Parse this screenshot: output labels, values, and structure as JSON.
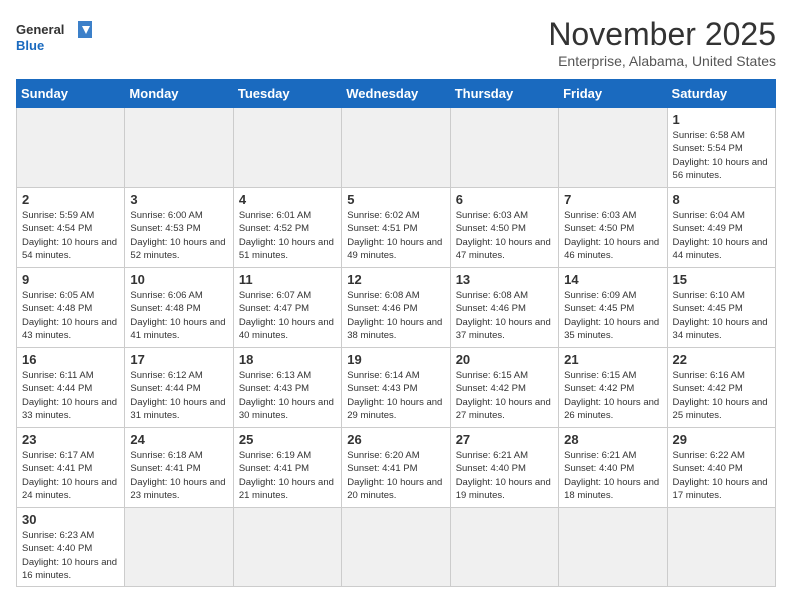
{
  "header": {
    "logo_line1": "General",
    "logo_line2": "Blue",
    "month": "November 2025",
    "location": "Enterprise, Alabama, United States"
  },
  "days_of_week": [
    "Sunday",
    "Monday",
    "Tuesday",
    "Wednesday",
    "Thursday",
    "Friday",
    "Saturday"
  ],
  "weeks": [
    [
      {
        "day": "",
        "info": ""
      },
      {
        "day": "",
        "info": ""
      },
      {
        "day": "",
        "info": ""
      },
      {
        "day": "",
        "info": ""
      },
      {
        "day": "",
        "info": ""
      },
      {
        "day": "",
        "info": ""
      },
      {
        "day": "1",
        "info": "Sunrise: 6:58 AM\nSunset: 5:54 PM\nDaylight: 10 hours and 56 minutes."
      }
    ],
    [
      {
        "day": "2",
        "info": "Sunrise: 5:59 AM\nSunset: 4:54 PM\nDaylight: 10 hours and 54 minutes."
      },
      {
        "day": "3",
        "info": "Sunrise: 6:00 AM\nSunset: 4:53 PM\nDaylight: 10 hours and 52 minutes."
      },
      {
        "day": "4",
        "info": "Sunrise: 6:01 AM\nSunset: 4:52 PM\nDaylight: 10 hours and 51 minutes."
      },
      {
        "day": "5",
        "info": "Sunrise: 6:02 AM\nSunset: 4:51 PM\nDaylight: 10 hours and 49 minutes."
      },
      {
        "day": "6",
        "info": "Sunrise: 6:03 AM\nSunset: 4:50 PM\nDaylight: 10 hours and 47 minutes."
      },
      {
        "day": "7",
        "info": "Sunrise: 6:03 AM\nSunset: 4:50 PM\nDaylight: 10 hours and 46 minutes."
      },
      {
        "day": "8",
        "info": "Sunrise: 6:04 AM\nSunset: 4:49 PM\nDaylight: 10 hours and 44 minutes."
      }
    ],
    [
      {
        "day": "9",
        "info": "Sunrise: 6:05 AM\nSunset: 4:48 PM\nDaylight: 10 hours and 43 minutes."
      },
      {
        "day": "10",
        "info": "Sunrise: 6:06 AM\nSunset: 4:48 PM\nDaylight: 10 hours and 41 minutes."
      },
      {
        "day": "11",
        "info": "Sunrise: 6:07 AM\nSunset: 4:47 PM\nDaylight: 10 hours and 40 minutes."
      },
      {
        "day": "12",
        "info": "Sunrise: 6:08 AM\nSunset: 4:46 PM\nDaylight: 10 hours and 38 minutes."
      },
      {
        "day": "13",
        "info": "Sunrise: 6:08 AM\nSunset: 4:46 PM\nDaylight: 10 hours and 37 minutes."
      },
      {
        "day": "14",
        "info": "Sunrise: 6:09 AM\nSunset: 4:45 PM\nDaylight: 10 hours and 35 minutes."
      },
      {
        "day": "15",
        "info": "Sunrise: 6:10 AM\nSunset: 4:45 PM\nDaylight: 10 hours and 34 minutes."
      }
    ],
    [
      {
        "day": "16",
        "info": "Sunrise: 6:11 AM\nSunset: 4:44 PM\nDaylight: 10 hours and 33 minutes."
      },
      {
        "day": "17",
        "info": "Sunrise: 6:12 AM\nSunset: 4:44 PM\nDaylight: 10 hours and 31 minutes."
      },
      {
        "day": "18",
        "info": "Sunrise: 6:13 AM\nSunset: 4:43 PM\nDaylight: 10 hours and 30 minutes."
      },
      {
        "day": "19",
        "info": "Sunrise: 6:14 AM\nSunset: 4:43 PM\nDaylight: 10 hours and 29 minutes."
      },
      {
        "day": "20",
        "info": "Sunrise: 6:15 AM\nSunset: 4:42 PM\nDaylight: 10 hours and 27 minutes."
      },
      {
        "day": "21",
        "info": "Sunrise: 6:15 AM\nSunset: 4:42 PM\nDaylight: 10 hours and 26 minutes."
      },
      {
        "day": "22",
        "info": "Sunrise: 6:16 AM\nSunset: 4:42 PM\nDaylight: 10 hours and 25 minutes."
      }
    ],
    [
      {
        "day": "23",
        "info": "Sunrise: 6:17 AM\nSunset: 4:41 PM\nDaylight: 10 hours and 24 minutes."
      },
      {
        "day": "24",
        "info": "Sunrise: 6:18 AM\nSunset: 4:41 PM\nDaylight: 10 hours and 23 minutes."
      },
      {
        "day": "25",
        "info": "Sunrise: 6:19 AM\nSunset: 4:41 PM\nDaylight: 10 hours and 21 minutes."
      },
      {
        "day": "26",
        "info": "Sunrise: 6:20 AM\nSunset: 4:41 PM\nDaylight: 10 hours and 20 minutes."
      },
      {
        "day": "27",
        "info": "Sunrise: 6:21 AM\nSunset: 4:40 PM\nDaylight: 10 hours and 19 minutes."
      },
      {
        "day": "28",
        "info": "Sunrise: 6:21 AM\nSunset: 4:40 PM\nDaylight: 10 hours and 18 minutes."
      },
      {
        "day": "29",
        "info": "Sunrise: 6:22 AM\nSunset: 4:40 PM\nDaylight: 10 hours and 17 minutes."
      }
    ],
    [
      {
        "day": "30",
        "info": "Sunrise: 6:23 AM\nSunset: 4:40 PM\nDaylight: 10 hours and 16 minutes."
      },
      {
        "day": "",
        "info": ""
      },
      {
        "day": "",
        "info": ""
      },
      {
        "day": "",
        "info": ""
      },
      {
        "day": "",
        "info": ""
      },
      {
        "day": "",
        "info": ""
      },
      {
        "day": "",
        "info": ""
      }
    ]
  ]
}
